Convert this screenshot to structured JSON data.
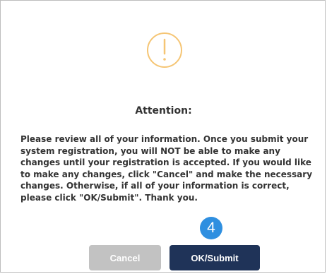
{
  "dialog": {
    "icon": "exclamation-circle-icon",
    "title": "Attention:",
    "message": "Please review all of your information. Once you submit your system registration, you will NOT be able to make any changes until your registration is accepted. If you would like to make any changes, click \"Cancel\" and make the necessary changes. Otherwise, if all of your information is correct, please click \"OK/Submit\". Thank you.",
    "step_badge": "4",
    "cancel_label": "Cancel",
    "submit_label": "OK/Submit"
  },
  "colors": {
    "icon": "#f5c574",
    "text": "#333333",
    "cancel_bg": "#c2c2c2",
    "submit_bg": "#1f3358",
    "badge_bg": "#2f8fe0"
  }
}
